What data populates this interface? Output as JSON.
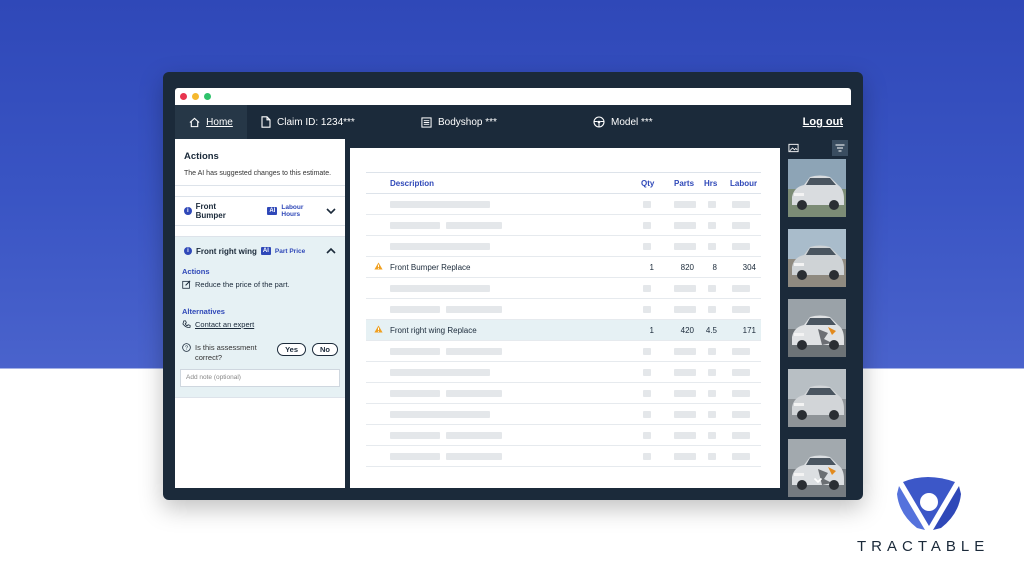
{
  "nav": {
    "home": "Home",
    "claim": "Claim ID:  1234***",
    "bodyshop": "Bodyshop ***",
    "model": "Model ***",
    "logout": "Log out"
  },
  "actions_panel": {
    "title": "Actions",
    "subtitle": "The AI has suggested changes to this estimate.",
    "items": [
      {
        "name": "Front Bumper",
        "badge": "AI",
        "tag": "Labour Hours"
      },
      {
        "name": "Front right wing",
        "badge": "AI",
        "tag": "Part Price"
      }
    ],
    "actions_title": "Actions",
    "action_text": "Reduce the price of the part.",
    "alternatives_title": "Alternatives",
    "alternative_link": "Contact an expert",
    "assessment_question": "Is this assessment correct?",
    "yes": "Yes",
    "no": "No",
    "note_placeholder": "Add note (optional)"
  },
  "table": {
    "headers": {
      "description": "Description",
      "qty": "Qty",
      "parts": "Parts",
      "hrs": "Hrs",
      "labour": "Labour"
    },
    "rows": [
      {
        "description": "Front Bumper Replace",
        "qty": "1",
        "parts": "820",
        "hrs": "8",
        "labour": "304"
      },
      {
        "description": "Front right wing Replace",
        "qty": "1",
        "parts": "420",
        "hrs": "4.5",
        "labour": "171"
      }
    ]
  },
  "gallery": {
    "photo_count": 5
  },
  "brand": {
    "name": "TRACTABLE",
    "accent": "#2f48b8",
    "dark": "#1b2a3a",
    "highlight": "#e6f1f4",
    "warning": "#f0a020"
  }
}
